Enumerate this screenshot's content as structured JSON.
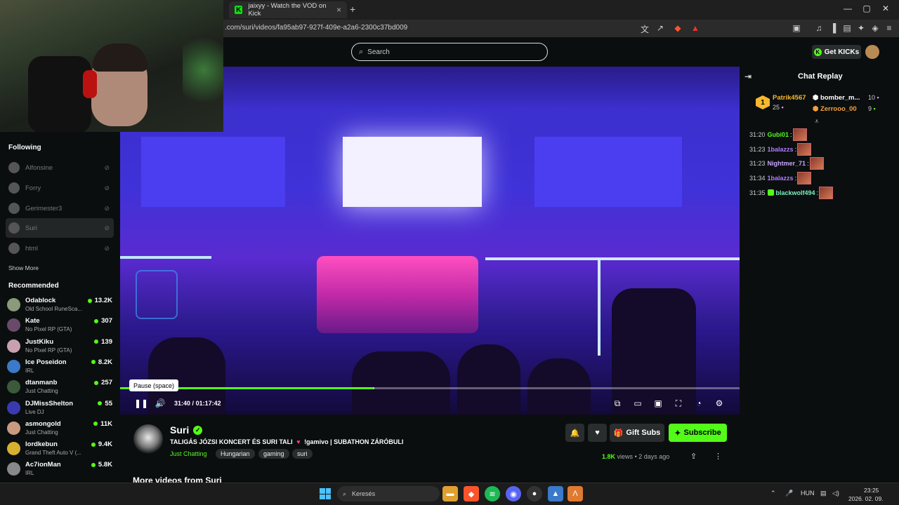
{
  "browser": {
    "tab_title": "jaixyy - Watch the VOD on Kick",
    "tab_icon_letter": "K",
    "url": ".com/suri/videos/fa95ab97-927f-409e-a2a6-2300c37bd009",
    "new_tab": "+",
    "close_tab": "×"
  },
  "header": {
    "search_placeholder": "Search",
    "get_kicks_label": "Get KICKs"
  },
  "sidebar": {
    "following_heading": "Following",
    "following": [
      {
        "name": "Alfonsine"
      },
      {
        "name": "Forry"
      },
      {
        "name": "Gerimester3"
      },
      {
        "name": "Suri"
      },
      {
        "name": "html"
      }
    ],
    "show_more": "Show More",
    "recommended_heading": "Recommended",
    "recommended": [
      {
        "name": "Odablock",
        "category": "Old School RuneSca...",
        "viewers": "13.2K",
        "color": "#8a9a7a"
      },
      {
        "name": "Kate",
        "category": "No Pixel RP (GTA)",
        "viewers": "307",
        "color": "#6a4a6a"
      },
      {
        "name": "JustKiku",
        "category": "No Pixel RP (GTA)",
        "viewers": "139",
        "color": "#c8a0b0"
      },
      {
        "name": "Ice Poseidon",
        "category": "IRL",
        "viewers": "8.2K",
        "color": "#3a7ac8"
      },
      {
        "name": "dtanmanb",
        "category": "Just Chatting",
        "viewers": "257",
        "color": "#3a5a3a"
      },
      {
        "name": "DJMissShelton",
        "category": "Live DJ",
        "viewers": "55",
        "color": "#3a3ab0"
      },
      {
        "name": "asmongold",
        "category": "Just Chatting",
        "viewers": "11K",
        "color": "#c89a80"
      },
      {
        "name": "lordkebun",
        "category": "Grand Theft Auto V (...",
        "viewers": "9.4K",
        "color": "#d8b030"
      },
      {
        "name": "Ac7ionMan",
        "category": "IRL",
        "viewers": "5.8K",
        "color": "#888888"
      }
    ]
  },
  "player": {
    "tooltip": "Pause (space)",
    "current_time": "31:40",
    "separator": "/",
    "duration": "01:17:42",
    "progress_fraction": 0.4076,
    "buffer_fraction": 0.41,
    "icons": {
      "play_pause": "pause-icon",
      "volume": "volume-icon",
      "miniplayer": "miniplayer-icon",
      "theater": "theater-icon",
      "clip": "clip-icon",
      "fullscreen": "fullscreen-icon",
      "speed": "speed-icon",
      "settings": "settings-icon"
    }
  },
  "channel": {
    "name": "Suri",
    "title_part1": "TALIGÁS JÓZSI KONCERT ÉS SURI TALI",
    "title_heart": "♥",
    "title_part2": "!gamivo | SUBATHON ZÁRÓBULI",
    "category": "Just Chatting",
    "tags": [
      "Hungarian",
      "gaming",
      "suri"
    ],
    "gift_subs_label": "Gift Subs",
    "subscribe_label": "Subscribe",
    "views_count": "1.8K",
    "views_label": "views",
    "dot": "•",
    "posted": "2 days ago",
    "more_videos_heading": "More videos from Suri"
  },
  "chat": {
    "title": "Chat Replay",
    "top_gifters": [
      {
        "rank": "1",
        "name": "Patrik4567",
        "count": "25",
        "color": "#f5b82e"
      },
      {
        "name": "bomber_m...",
        "count": "10",
        "color": "#ffffff"
      },
      {
        "name": "Zerrooo_00",
        "count": "9",
        "color": "#f5a03e"
      }
    ],
    "messages": [
      {
        "time": "31:20",
        "user": "Gubi01",
        "color": "#53fc18",
        "sub": false
      },
      {
        "time": "31:23",
        "user": "1balazzs",
        "color": "#b07cff",
        "sub": false
      },
      {
        "time": "31:23",
        "user": "Nightmer_71",
        "color": "#c7a6ff",
        "sub": false
      },
      {
        "time": "31:34",
        "user": "1balazzs",
        "color": "#b07cff",
        "sub": false
      },
      {
        "time": "31:35",
        "user": "blackwolf494",
        "color": "#7af0c0",
        "sub": true
      }
    ]
  },
  "taskbar": {
    "search_placeholder": "Keresés",
    "language": "HUN",
    "time": "23:25",
    "date": "2026. 02. 09."
  },
  "colors": {
    "accent": "#53fc18",
    "background": "#0b0e0f",
    "button_bg": "#2a2d2e"
  }
}
